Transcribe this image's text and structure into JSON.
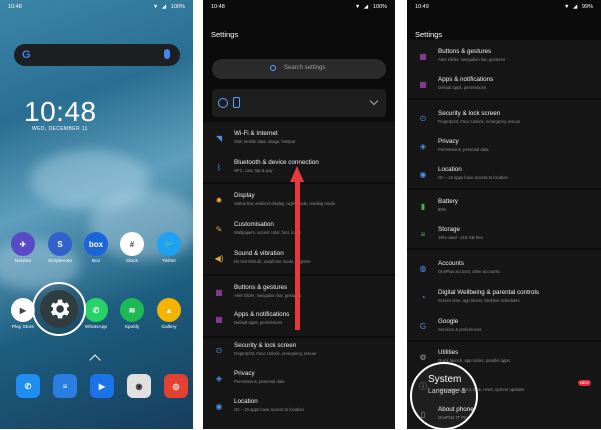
{
  "home": {
    "status": {
      "time": "10:48",
      "battery": "100%"
    },
    "clock": "10:48",
    "date": "WED, DECEMBER 11",
    "apps_row1": [
      {
        "label": "Newton",
        "color": "#5a4ac8",
        "glyph": "✈"
      },
      {
        "label": "Simplenote",
        "color": "#3361cc",
        "glyph": "S"
      },
      {
        "label": "Box",
        "color": "#1b64d9",
        "glyph": "box"
      },
      {
        "label": "Slack",
        "color": "#ffffff",
        "glyph": "#"
      },
      {
        "label": "Twitter",
        "color": "#1da1f2",
        "glyph": "🐦"
      }
    ],
    "apps_row2": [
      {
        "label": "Play Store",
        "color": "#ffffff",
        "glyph": "▶"
      },
      {
        "label": "WhatsApp",
        "color": "#25d366",
        "glyph": "✆"
      },
      {
        "label": "Spotify",
        "color": "#1db954",
        "glyph": "≋"
      },
      {
        "label": "Gallery",
        "color": "#f4b400",
        "glyph": "▲"
      }
    ],
    "dock": [
      {
        "name": "phone-icon",
        "color": "#1f8ef1",
        "glyph": "✆"
      },
      {
        "name": "messages-icon",
        "color": "#2a7de1",
        "glyph": "≡"
      },
      {
        "name": "duo-icon",
        "color": "#1a73e8",
        "glyph": "▶"
      },
      {
        "name": "camera-icon",
        "color": "#e0e0e0",
        "glyph": "◉"
      },
      {
        "name": "chrome-icon",
        "color": "#e34133",
        "glyph": "◎"
      }
    ]
  },
  "settings1": {
    "status": {
      "time": "10:48",
      "battery": "100%"
    },
    "title": "Settings",
    "search_placeholder": "Search settings",
    "items": [
      {
        "title": "Wi-Fi & Internet",
        "sub": "SIM, mobile data, usage, hotspot",
        "icon": "wifi-icon",
        "glyph": "◥",
        "color": "#4a90e2"
      },
      {
        "title": "Bluetooth & device connection",
        "sub": "NFC, cast, tap & pay",
        "icon": "bluetooth-icon",
        "glyph": "ᛒ",
        "color": "#4a90e2"
      },
      {
        "title": "Display",
        "sub": "Status bar, ambient display, night mode, reading mode",
        "icon": "display-icon",
        "glyph": "✹",
        "color": "#e6a23c"
      },
      {
        "title": "Customisation",
        "sub": "Wallpapers, accent color, font, icons",
        "icon": "customisation-icon",
        "glyph": "✎",
        "color": "#e6a23c"
      },
      {
        "title": "Sound & vibration",
        "sub": "Do Not Disturb, earphone mode, ringtone",
        "icon": "sound-icon",
        "glyph": "◀)",
        "color": "#e6a23c"
      },
      {
        "title": "Buttons & gestures",
        "sub": "Alert Slider, navigation bar, gestures",
        "icon": "buttons-icon",
        "glyph": "▦",
        "color": "#ab47bc"
      },
      {
        "title": "Apps & notifications",
        "sub": "Default apps, permissions",
        "icon": "apps-icon",
        "glyph": "▦",
        "color": "#ab47bc"
      },
      {
        "title": "Security & lock screen",
        "sub": "Fingerprint, Face Unlock, emergency rescue",
        "icon": "lock-icon",
        "glyph": "⊙",
        "color": "#4a90e2"
      },
      {
        "title": "Privacy",
        "sub": "Permissions, personal data",
        "icon": "privacy-icon",
        "glyph": "◈",
        "color": "#4a90e2"
      },
      {
        "title": "Location",
        "sub": "On – 19 apps have access to location",
        "icon": "location-icon",
        "glyph": "◉",
        "color": "#4a90e2"
      }
    ]
  },
  "settings2": {
    "status": {
      "time": "10:49",
      "battery": "99%"
    },
    "title": "Settings",
    "items": [
      {
        "title": "Buttons & gestures",
        "sub": "Alert Slider, navigation bar, gestures",
        "icon": "buttons-icon",
        "glyph": "▦",
        "color": "#ab47bc"
      },
      {
        "title": "Apps & notifications",
        "sub": "Default apps, permissions",
        "icon": "apps-icon",
        "glyph": "▦",
        "color": "#ab47bc"
      },
      {
        "title": "Security & lock screen",
        "sub": "Fingerprint, Face Unlock, emergency rescue",
        "icon": "lock-icon",
        "glyph": "⊙",
        "color": "#4a90e2"
      },
      {
        "title": "Privacy",
        "sub": "Permissions, personal data",
        "icon": "privacy-icon",
        "glyph": "◈",
        "color": "#4a90e2"
      },
      {
        "title": "Location",
        "sub": "On – 19 apps have access to location",
        "icon": "location-icon",
        "glyph": "◉",
        "color": "#4a90e2"
      },
      {
        "title": "Battery",
        "sub": "99%",
        "icon": "battery-icon",
        "glyph": "▮",
        "color": "#4caf50"
      },
      {
        "title": "Storage",
        "sub": "16% used - 216 GB free",
        "icon": "storage-icon",
        "glyph": "≡",
        "color": "#4caf50"
      },
      {
        "title": "Accounts",
        "sub": "OnePlus account, other accounts",
        "icon": "accounts-icon",
        "glyph": "◍",
        "color": "#4a90e2"
      },
      {
        "title": "Digital Wellbeing & parental controls",
        "sub": "Screen time, app timers, bedtime schedules",
        "icon": "wellbeing-icon",
        "glyph": "◔",
        "color": "#4a90e2"
      },
      {
        "title": "Google",
        "sub": "Services & preferences",
        "icon": "google-icon",
        "glyph": "G",
        "color": "#4a90e2"
      },
      {
        "title": "Utilities",
        "sub": "Quick launch, app locker, parallel apps",
        "icon": "utilities-icon",
        "glyph": "⚙",
        "color": "#9e9e9e"
      },
      {
        "title": "",
        "sub": "Language & input, time, reset, system updates",
        "icon": "system-icon",
        "glyph": "ⓘ",
        "color": "#9e9e9e"
      },
      {
        "title": "About phone",
        "sub": "OnePlus 7T Pro",
        "icon": "about-icon",
        "glyph": "▯",
        "color": "#9e9e9e"
      }
    ],
    "system_highlight": {
      "title": "System",
      "sub": "Language &"
    },
    "new_badge": "NEW"
  }
}
